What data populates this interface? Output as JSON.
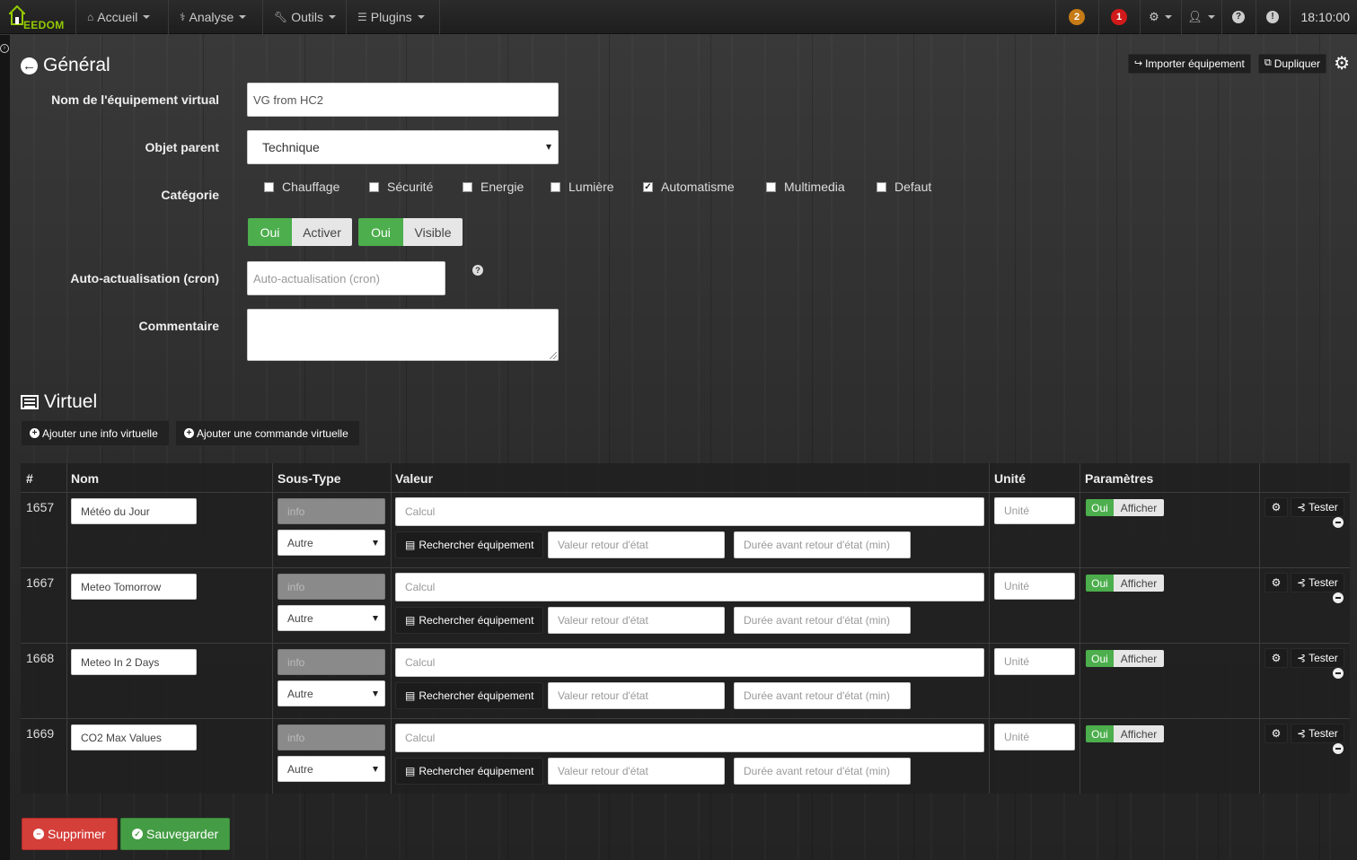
{
  "nav": {
    "brand": "EEDOM",
    "menus": [
      {
        "label": "Accueil",
        "icon": "home-icon"
      },
      {
        "label": "Analyse",
        "icon": "stethoscope-icon"
      },
      {
        "label": "Outils",
        "icon": "wrench-icon"
      },
      {
        "label": "Plugins",
        "icon": "tasks-icon"
      }
    ],
    "badge_orange": "2",
    "badge_red": "1",
    "time": "18:10:00"
  },
  "general": {
    "title": "Général",
    "import_label": "Importer équipement",
    "duplicate_label": "Dupliquer",
    "name_label": "Nom de l'équipement virtual",
    "name_value": "VG from HC2",
    "parent_label": "Objet parent",
    "parent_value": "Technique",
    "category_label": "Catégorie",
    "categories": [
      {
        "label": "Chauffage",
        "checked": false
      },
      {
        "label": "Sécurité",
        "checked": false
      },
      {
        "label": "Energie",
        "checked": false
      },
      {
        "label": "Lumière",
        "checked": false
      },
      {
        "label": "Automatisme",
        "checked": true
      },
      {
        "label": "Multimedia",
        "checked": false
      },
      {
        "label": "Defaut",
        "checked": false
      }
    ],
    "enable_on": "Oui",
    "enable_label": "Activer",
    "visible_on": "Oui",
    "visible_label": "Visible",
    "cron_label": "Auto-actualisation (cron)",
    "cron_placeholder": "Auto-actualisation (cron)",
    "comment_label": "Commentaire"
  },
  "virtual": {
    "title": "Virtuel",
    "add_info": "Ajouter une info virtuelle",
    "add_command": "Ajouter une commande virtuelle",
    "headers": {
      "id": "#",
      "name": "Nom",
      "subtype": "Sous-Type",
      "value": "Valeur",
      "unit": "Unité",
      "params": "Paramètres"
    },
    "rows": [
      {
        "id": "1657",
        "name": "Météo du Jour",
        "type": "info",
        "subtype": "Autre"
      },
      {
        "id": "1667",
        "name": "Meteo Tomorrow",
        "type": "info",
        "subtype": "Autre"
      },
      {
        "id": "1668",
        "name": "Meteo In 2 Days",
        "type": "info",
        "subtype": "Autre"
      },
      {
        "id": "1669",
        "name": "CO2 Max Values",
        "type": "info",
        "subtype": "Autre"
      }
    ],
    "calc_placeholder": "Calcul",
    "search_label": "Rechercher équipement",
    "return_placeholder": "Valeur retour d'état",
    "duration_placeholder": "Durée avant retour d'état (min)",
    "unit_placeholder": "Unité",
    "show_on": "Oui",
    "show_label": "Afficher",
    "test_label": "Tester"
  },
  "footer": {
    "delete_label": "Supprimer",
    "save_label": "Sauvegarder"
  },
  "colors": {
    "success": "#4cae4c",
    "danger": "#d43f3a",
    "brand": "#94ca02"
  }
}
